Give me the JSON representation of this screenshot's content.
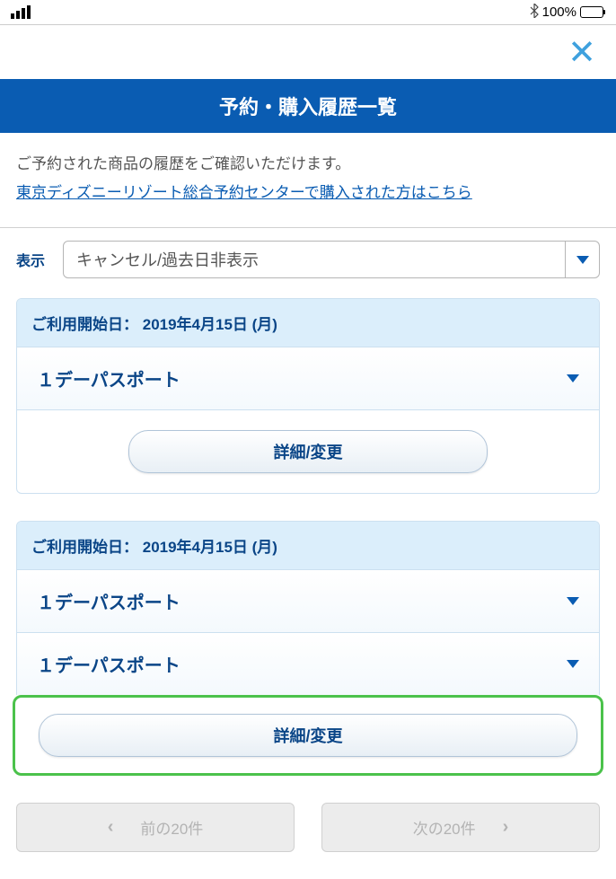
{
  "statusBar": {
    "bluetooth": "✱",
    "battery": "100%"
  },
  "closeLabel": "✕",
  "pageTitle": "予約・購入履歴一覧",
  "intro": {
    "text": "ご予約された商品の履歴をご確認いただけます。",
    "link": "東京ディズニーリゾート総合予約センターで購入された方はこちら"
  },
  "filter": {
    "label": "表示",
    "selected": "キャンセル/過去日非表示"
  },
  "bookings": [
    {
      "dateLabel": "ご利用開始日：",
      "date": "2019年4月15日 (月)",
      "items": [
        "１デーパスポート"
      ],
      "detailBtn": "詳細/変更"
    },
    {
      "dateLabel": "ご利用開始日：",
      "date": "2019年4月15日 (月)",
      "items": [
        "１デーパスポート",
        "１デーパスポート"
      ],
      "detailBtn": "詳細/変更"
    }
  ],
  "pagination": {
    "prev": "前の20件",
    "next": "次の20件"
  }
}
